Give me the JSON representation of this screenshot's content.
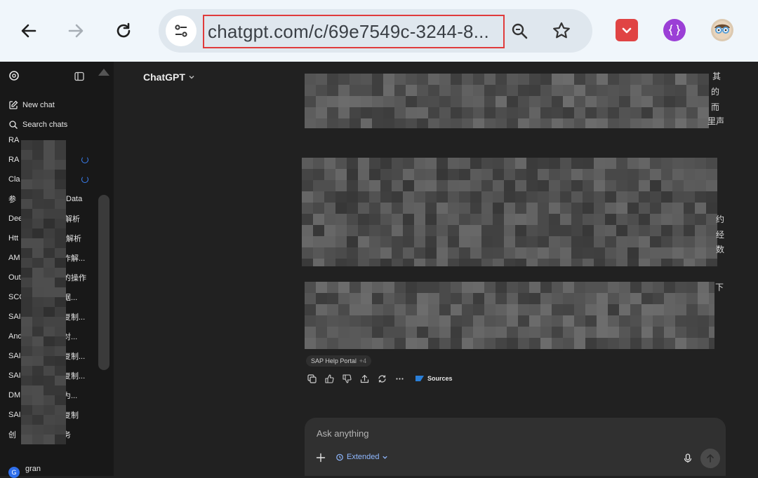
{
  "browser": {
    "url": "chatgpt.com/c/69e7549c-3244-8...",
    "colors": {
      "url_highlight": "#e03b3b",
      "pocket_ext": "#e04444",
      "ext2": "#9b3fd6"
    }
  },
  "sidebar": {
    "new_chat": "New chat",
    "search_chats": "Search chats",
    "items": [
      {
        "lead": "RA",
        "tail": ""
      },
      {
        "lead": "RA",
        "tail": ""
      },
      {
        "lead": "Cla",
        "tail": ""
      },
      {
        "lead": "参",
        "tail": "Data"
      },
      {
        "lead": "Dee",
        "tail": "解析"
      },
      {
        "lead": "Htt",
        "tail": "解析"
      },
      {
        "lead": "AM",
        "tail": "作解..."
      },
      {
        "lead": "Out",
        "tail": "的操作"
      },
      {
        "lead": "SCC",
        "tail": "据..."
      },
      {
        "lead": "SAI",
        "tail": "复制..."
      },
      {
        "lead": "And",
        "tail": "对..."
      },
      {
        "lead": "SAI",
        "tail": "复制..."
      },
      {
        "lead": "SAI",
        "tail": "复制..."
      },
      {
        "lead": "DM",
        "tail": "为..."
      },
      {
        "lead": "SAI",
        "tail": "复制"
      },
      {
        "lead": "创",
        "tail": "务"
      }
    ],
    "user": {
      "initial": "G",
      "name": "gran"
    }
  },
  "main": {
    "model": "ChatGPT",
    "visible_text": {
      "f1": "其",
      "f2": "的",
      "f3": "而",
      "f4": "里声",
      "f5": "约",
      "f6": "经",
      "f7": "数",
      "f8": "下"
    },
    "source_chip": {
      "label": "SAP Help Portal",
      "count": "+4"
    },
    "sources_label": "Sources"
  },
  "composer": {
    "placeholder": "Ask anything",
    "tool": "Extended"
  }
}
